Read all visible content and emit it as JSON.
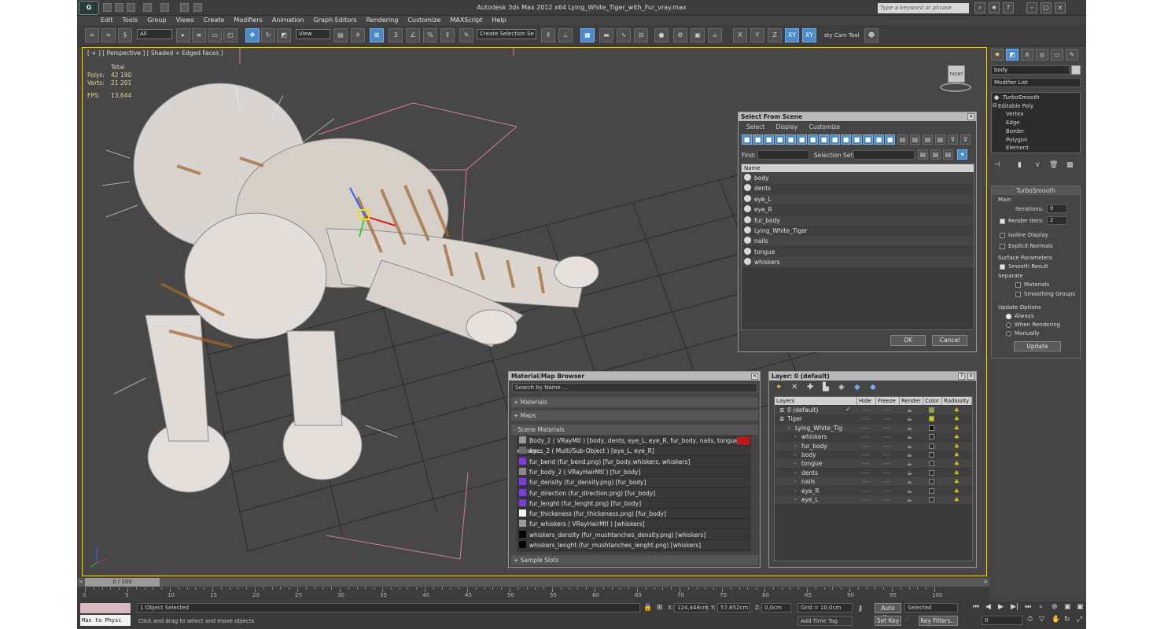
{
  "window": {
    "title": "Autodesk 3ds Max  2012 x64     Lying_White_Tiger_with_Fur_vray.max",
    "search_placeholder": "Type a keyword or phrase"
  },
  "menu": [
    "Edit",
    "Tools",
    "Group",
    "Views",
    "Create",
    "Modifiers",
    "Animation",
    "Graph Editors",
    "Rendering",
    "Customize",
    "MAXScript",
    "Help"
  ],
  "toolbar": {
    "filter": "All",
    "ref_coord": "View",
    "named_sel": "Create Selection Se",
    "axes": [
      "X",
      "Y",
      "Z",
      "XY",
      "XY"
    ],
    "cam_tool": "sty Cam Tool"
  },
  "viewport": {
    "label": "[ + ] [ Perspective ] [ Shaded + Edged Faces ]",
    "stats": {
      "total_label": "Total",
      "polys_label": "Polys:",
      "polys": "42 190",
      "verts_label": "Verts:",
      "verts": "21 201",
      "fps_label": "FPS:",
      "fps": "13,644"
    },
    "viewcube": "FRONT"
  },
  "select_dialog": {
    "title": "Select From Scene",
    "menu": [
      "Select",
      "Display",
      "Customize"
    ],
    "find_label": "Find:",
    "selset_label": "Selection Set:",
    "col_header": "Name",
    "items": [
      "body",
      "dents",
      "eye_L",
      "eye_R",
      "fur_body",
      "Lying_White_Tiger",
      "nails",
      "tongue",
      "whiskers"
    ],
    "ok": "OK",
    "cancel": "Cancel"
  },
  "material_browser": {
    "title": "Material/Map Browser",
    "search": "Search by Name ...",
    "groups": {
      "materials": "+ Materials",
      "maps": "+ Maps",
      "scene": "- Scene Materials",
      "samples": "+ Sample Slots"
    },
    "items": [
      {
        "text": "Body_2  ( VRayMtl ) [body, dents, eye_L, eye_R, fur_body, nails, tongue, whiske...",
        "color": "#9a9a9a"
      },
      {
        "text": "eyes_2  ( Multi/Sub-Object ) [eye_L, eye_R]",
        "color": "#6a6a6a"
      },
      {
        "text": "fur_bend (fur_bend.png) [fur_body,whiskers, whiskers]",
        "color": "#7b3fd0"
      },
      {
        "text": "fur_body_2  ( VRayHairMtl ) [fur_body]",
        "color": "#8a8a8a"
      },
      {
        "text": "fur_density (fur_density.png) [fur_body]",
        "color": "#7b3fd0"
      },
      {
        "text": "fur_direction (fur_direction.png) [fur_body]",
        "color": "#7b3fd0"
      },
      {
        "text": "fur_lenght (fur_lenght.png) [fur_body]",
        "color": "#7b3fd0"
      },
      {
        "text": "fur_thickeness (fur_thickeness.png) [fur_body]",
        "color": "#f2f2f2"
      },
      {
        "text": "fur_whiskers  ( VRayHairMtl ) [whiskers]",
        "color": "#9a9a9a"
      },
      {
        "text": "whiskers_density (fur_mushtanches_density.png) [whiskers]",
        "color": "#050505"
      },
      {
        "text": "whiskers_lenght (fur_mushtanches_lenght.png) [whiskers]",
        "color": "#050505"
      }
    ]
  },
  "layer_dialog": {
    "title": "Layer: 0 (default)",
    "columns": [
      "Layers",
      "Hide",
      "Freeze",
      "Render",
      "Color",
      "Radiosity"
    ],
    "rows": [
      {
        "name": "0 (default)",
        "color": "#a0a020"
      },
      {
        "name": "Tiger",
        "color": "#c8c820"
      },
      {
        "name": "Lying_White_Tig",
        "color": "#101010"
      },
      {
        "name": "whiskers",
        "color": "#303030"
      },
      {
        "name": "fur_body",
        "color": "#303030"
      },
      {
        "name": "body",
        "color": "#303030"
      },
      {
        "name": "tongue",
        "color": "#303030"
      },
      {
        "name": "dents",
        "color": "#303030"
      },
      {
        "name": "nails",
        "color": "#303030"
      },
      {
        "name": "eye_R",
        "color": "#303030"
      },
      {
        "name": "eye_L",
        "color": "#303030"
      }
    ],
    "help": "?",
    "dash": "----"
  },
  "command_panel": {
    "object_name": "body",
    "modifier_list": "Modifier List",
    "stack": [
      "TurboSmooth",
      "Editable Poly",
      "Vertex",
      "Edge",
      "Border",
      "Polygon",
      "Element"
    ],
    "rollout": {
      "title": "TurboSmooth",
      "main": "Main",
      "iterations_label": "Iterations:",
      "iterations": "0",
      "render_iters_label": "Render Iters:",
      "render_iters": "2",
      "isoline": "Isoline Display",
      "explicit": "Explicit Normals",
      "surface": "Surface Parameters",
      "smooth_result": "Smooth Result",
      "separate": "Separate",
      "materials": "Materials",
      "smoothing": "Smoothing Groups",
      "update_options": "Update Options",
      "always": "Always",
      "when_rendering": "When Rendering",
      "manually": "Manually",
      "update": "Update"
    }
  },
  "timeline": {
    "frame": "0 / 100",
    "ticks": [
      "0",
      "5",
      "10",
      "15",
      "20",
      "25",
      "30",
      "35",
      "40",
      "45",
      "50",
      "55",
      "60",
      "65",
      "70",
      "75",
      "80",
      "85",
      "90",
      "95",
      "100"
    ]
  },
  "status": {
    "listener": "Max to Physc",
    "selected": "1 Object Selected",
    "prompt": "Click and drag to select and move objects",
    "x_label": "X:",
    "x": "124,448cm",
    "y_label": "Y:",
    "y": "57,652cm",
    "z_label": "Z:",
    "z": "0,0cm",
    "grid": "Grid = 10,0cm",
    "add_time_tag": "Add Time Tag",
    "auto_key": "Auto Key",
    "set_key": "Set Key",
    "selected_dd": "Selected",
    "key_filters": "Key Filters...",
    "frame": "0"
  }
}
